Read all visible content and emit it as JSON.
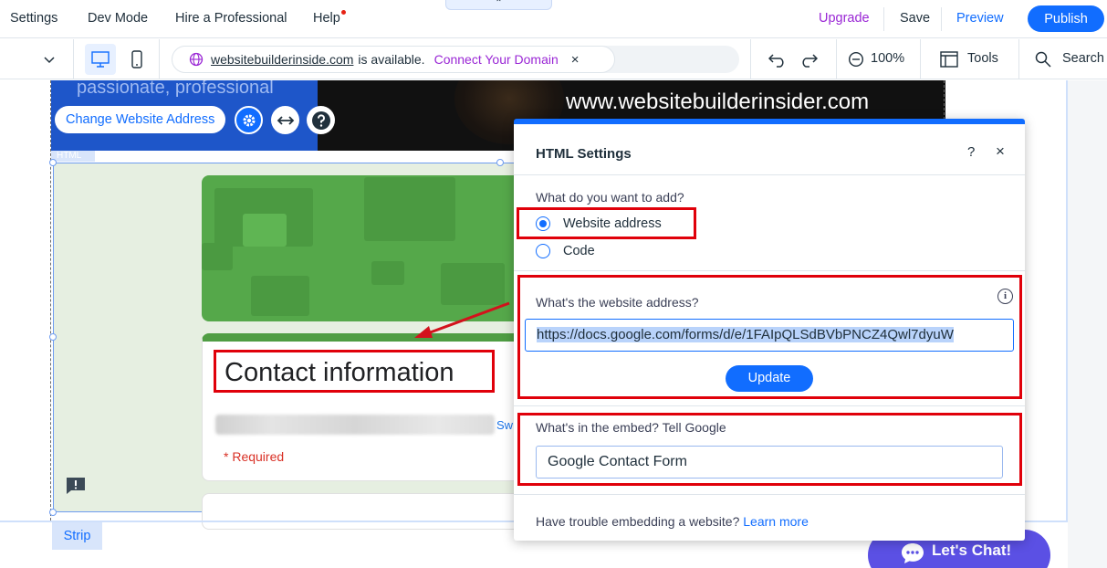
{
  "topbar": {
    "menu": [
      "Settings",
      "Dev Mode",
      "Hire a Professional",
      "Help"
    ],
    "upgrade": "Upgrade",
    "save": "Save",
    "preview": "Preview",
    "publish": "Publish",
    "collapse_glyph": "⌃"
  },
  "toolbar": {
    "domain": "websitebuilderinside.com",
    "availability": "is available.",
    "connect": "Connect Your Domain",
    "dismiss": "×",
    "zoom": "100%",
    "tools": "Tools",
    "search": "Search"
  },
  "site": {
    "tagline": "passionate, professional",
    "banner_url": "www.websitebuilderinsider.com",
    "change_address": "Change Website Address",
    "html_tag": "HTML",
    "form_title": "Contact information",
    "switch_link": "Sw",
    "required": "* Required",
    "strip": "Strip",
    "chat": "Let's Chat!"
  },
  "panel": {
    "title": "HTML Settings",
    "help": "?",
    "close": "×",
    "question": "What do you want to add?",
    "options": [
      "Website address",
      "Code"
    ],
    "selected_option": "Website address",
    "address_label": "What's the website address?",
    "info": "i",
    "address_value": "https://docs.google.com/forms/d/e/1FAIpQLSdBVbPNCZ4Qwl7dyuW",
    "update": "Update",
    "embed_label": "What's in the embed? Tell Google",
    "embed_value": "Google Contact Form",
    "footer_text": "Have trouble embedding a website?",
    "footer_link": "Learn more"
  },
  "colors": {
    "accent": "#116dff",
    "upgrade": "#9a27d5",
    "highlight_red": "#e0000a",
    "form_green": "#55a84a",
    "chat": "#5b50e4"
  },
  "icons": [
    "chevron-down-icon",
    "desktop-icon",
    "mobile-icon",
    "globe-icon",
    "undo-icon",
    "redo-icon",
    "zoom-out-icon",
    "tools-icon",
    "search-icon",
    "gear-icon",
    "stretch-icon",
    "help-icon",
    "comment-icon",
    "info-icon",
    "chat-icon"
  ]
}
